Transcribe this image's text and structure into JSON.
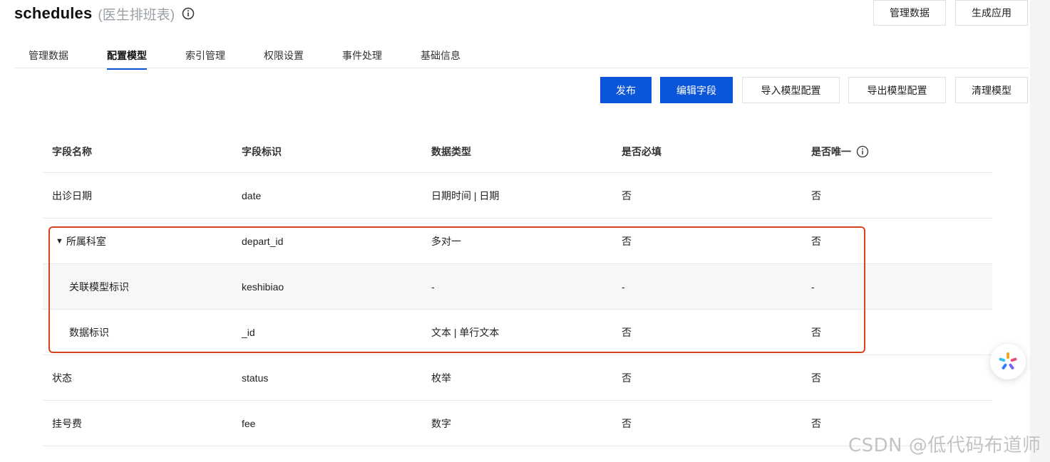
{
  "page": {
    "title": "schedules",
    "subtitle": "(医生排班表)",
    "top_buttons": [
      "管理数据",
      "生成应用"
    ]
  },
  "tabs": [
    {
      "label": "管理数据",
      "active": false
    },
    {
      "label": "配置模型",
      "active": true
    },
    {
      "label": "索引管理",
      "active": false
    },
    {
      "label": "权限设置",
      "active": false
    },
    {
      "label": "事件处理",
      "active": false
    },
    {
      "label": "基础信息",
      "active": false
    }
  ],
  "toolbar": {
    "publish": "发布",
    "edit_fields": "编辑字段",
    "import_config": "导入模型配置",
    "export_config": "导出模型配置",
    "clear_model": "清理模型"
  },
  "table": {
    "headers": [
      "字段名称",
      "字段标识",
      "数据类型",
      "是否必填",
      "是否唯一"
    ],
    "rows": [
      {
        "name": "出诊日期",
        "id": "date",
        "type": "日期时间 | 日期",
        "required": "否",
        "unique": "否"
      },
      {
        "name": "所属科室",
        "id": "depart_id",
        "type": "多对一",
        "required": "否",
        "unique": "否",
        "expanded": true
      },
      {
        "name": "关联模型标识",
        "id": "keshibiao",
        "type": "-",
        "required": "-",
        "unique": "-",
        "sub": true
      },
      {
        "name": "数据标识",
        "id": "_id",
        "type": "文本 | 单行文本",
        "required": "否",
        "unique": "否",
        "sub": true
      },
      {
        "name": "状态",
        "id": "status",
        "type": "枚举",
        "required": "否",
        "unique": "否"
      },
      {
        "name": "挂号费",
        "id": "fee",
        "type": "数字",
        "required": "否",
        "unique": "否"
      }
    ]
  },
  "colors": {
    "primary": "#0b56d8",
    "highlight_border": "#d9431c"
  },
  "watermark": "CSDN @低代码布道师"
}
